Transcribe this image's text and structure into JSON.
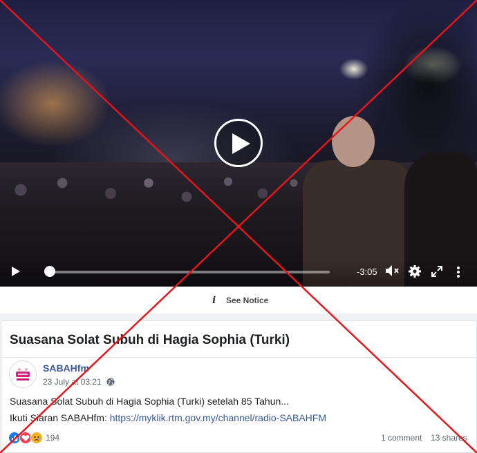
{
  "video": {
    "time_remaining": "-3:05",
    "progress_fraction": 0.02,
    "icons": {
      "play_center": "play-circle-icon",
      "play": "play-icon",
      "volume": "volume-muted-icon",
      "settings": "gear-icon",
      "fullscreen": "fullscreen-icon",
      "more": "more-vertical-icon"
    }
  },
  "notice": {
    "icon": "info-icon",
    "label": "See Notice"
  },
  "post": {
    "headline": "Suasana Solat Subuh di Hagia Sophia (Turki)",
    "author": "SABAHfm",
    "timestamp": "23 July at 03:21",
    "privacy_icon": "globe-icon",
    "text_line1": "Suasana Solat Subuh di Hagia Sophia (Turki) setelah 85 Tahun...",
    "text_line2_prefix": "Ikuti Siaran SABAHfm: ",
    "link": "https://myklik.rtm.gov.my/channel/radio-SABAHFM",
    "reaction_count": "194",
    "comments": "1 comment",
    "shares": "13 shares",
    "reaction_icons": [
      "like-icon",
      "love-icon",
      "sad-icon"
    ]
  },
  "overlay": {
    "mark": "red-x-mark",
    "color": "#e8141b"
  },
  "colors": {
    "link_blue": "#385898",
    "page_bg": "#f0f2f5"
  }
}
